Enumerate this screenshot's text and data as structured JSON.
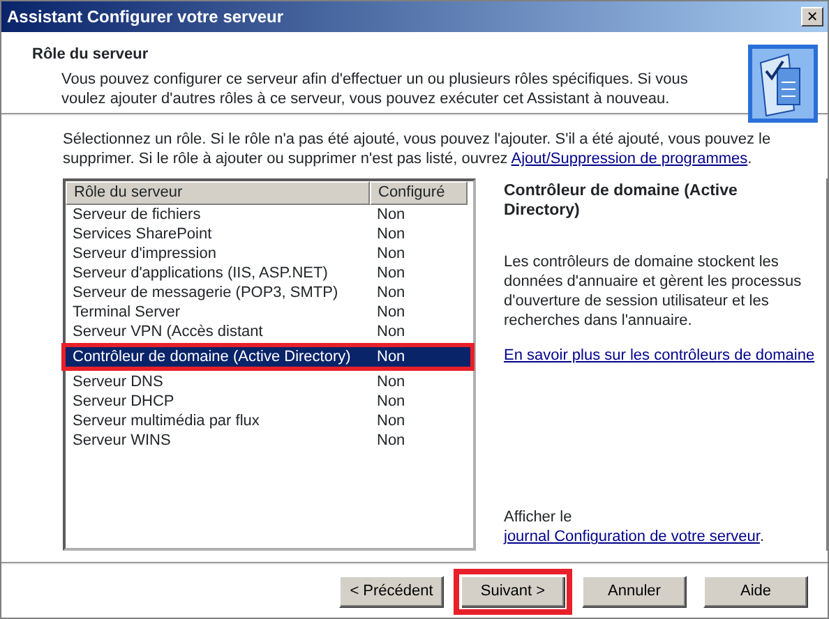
{
  "window": {
    "title": "Assistant Configurer votre serveur",
    "close_button": "×"
  },
  "header": {
    "title": "Rôle du serveur",
    "description": "Vous pouvez configurer ce serveur afin d'effectuer un ou plusieurs rôles spécifiques. Si vous voulez ajouter d'autres rôles à ce serveur, vous pouvez exécuter cet Assistant à nouveau."
  },
  "instructions": {
    "text": "Sélectionnez un rôle. Si le rôle n'a pas été ajouté, vous pouvez l'ajouter. S'il a été ajouté, vous pouvez le supprimer. Si le rôle à ajouter ou supprimer n'est pas listé, ouvrez",
    "link": "Ajout/Suppression de programmes",
    "after": "."
  },
  "table": {
    "columns": [
      "Rôle du serveur",
      "Configuré"
    ],
    "rows": [
      {
        "role": "Serveur de fichiers",
        "configured": "Non",
        "selected": false,
        "highlighted": false
      },
      {
        "role": "Services SharePoint",
        "configured": "Non",
        "selected": false,
        "highlighted": false
      },
      {
        "role": "Serveur d'impression",
        "configured": "Non",
        "selected": false,
        "highlighted": false
      },
      {
        "role": "Serveur d'applications (IIS, ASP.NET)",
        "configured": "Non",
        "selected": false,
        "highlighted": false
      },
      {
        "role": "Serveur de messagerie (POP3, SMTP)",
        "configured": "Non",
        "selected": false,
        "highlighted": false
      },
      {
        "role": "Terminal Server",
        "configured": "Non",
        "selected": false,
        "highlighted": false
      },
      {
        "role": "Serveur VPN (Accès distant",
        "configured": "Non",
        "selected": false,
        "highlighted": false
      },
      {
        "role": "Contrôleur de domaine (Active Directory)",
        "configured": "Non",
        "selected": true,
        "highlighted": true
      },
      {
        "role": "Serveur DNS",
        "configured": "Non",
        "selected": false,
        "highlighted": false
      },
      {
        "role": "Serveur DHCP",
        "configured": "Non",
        "selected": false,
        "highlighted": false
      },
      {
        "role": "Serveur multimédia par flux",
        "configured": "Non",
        "selected": false,
        "highlighted": false
      },
      {
        "role": "Serveur WINS",
        "configured": "Non",
        "selected": false,
        "highlighted": false
      }
    ]
  },
  "details": {
    "title": "Contrôleur de domaine (Active Directory)",
    "description": "Les contrôleurs de domaine stockent les données d'annuaire et gèrent les processus d'ouverture de session utilisateur et les recherches dans l'annuaire.",
    "more_link": "En savoir plus sur les contrôleurs de domaine",
    "log_text": "Afficher le",
    "log_link": "journal Configuration de votre serveur",
    "log_after": "."
  },
  "buttons": [
    {
      "label": "< Précédent",
      "highlighted": false
    },
    {
      "label": "Suivant >",
      "highlighted": true
    },
    {
      "label": "Annuler",
      "highlighted": false
    },
    {
      "label": "Aide",
      "highlighted": false
    }
  ]
}
